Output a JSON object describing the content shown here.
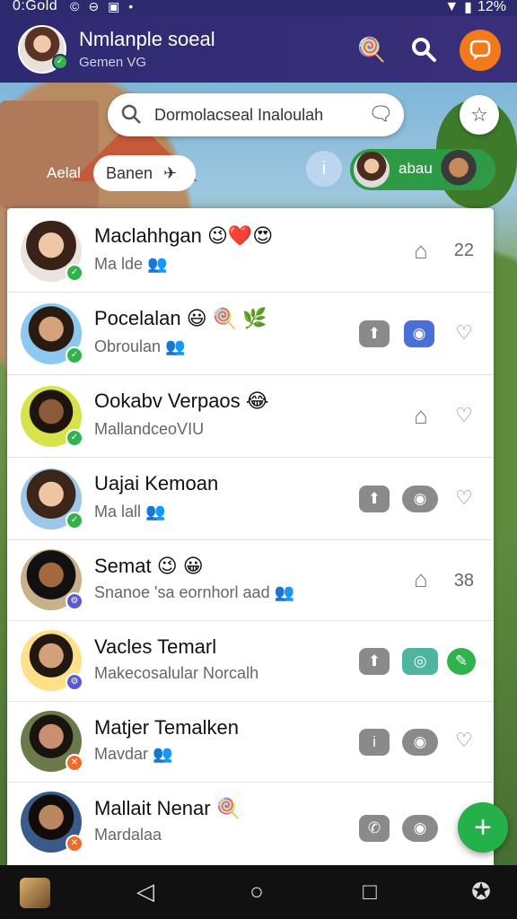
{
  "status_bar": {
    "time": "0:Gold",
    "icons": [
      "©",
      "⊖",
      "▣",
      "•"
    ],
    "battery": "12%"
  },
  "header": {
    "title": "Nmlanple soeal",
    "subtitle": "Gemen VG",
    "icons": [
      "lollipop-icon",
      "search-icon",
      "chat-icon"
    ],
    "colors": {
      "bg": "#2e2a72",
      "accent": "#f27a1a"
    }
  },
  "search": {
    "value": "Dormolacseal Inaloulah"
  },
  "filters": {
    "label": "Aelal",
    "pill_label": "Banen",
    "chip_label": "abau"
  },
  "contacts": [
    {
      "name": "Maclahhgan 😉❤️😍",
      "sub": "Ma lde 👥",
      "count": "22",
      "badge_color": "#2fb34a"
    },
    {
      "name": "Pocelalan 😃 🍭 🌿",
      "sub": "Obroulan 👥",
      "count": "",
      "badge_color": "#2fb34a"
    },
    {
      "name": "Ookabv Verpaos 😂",
      "sub": "MallandceoVIU",
      "count": "",
      "badge_color": "#2fb34a"
    },
    {
      "name": "Uajai Kemoan",
      "sub": "Ma lall 👥",
      "count": "",
      "badge_color": "#2fb34a"
    },
    {
      "name": "Semat 😉 😀",
      "sub": "Snanoe 'sa eornhorl aad 👥",
      "count": "38",
      "badge_color": "#5a5ad0"
    },
    {
      "name": "Vacles Temarl",
      "sub": "Makecosalular Norcalh",
      "count": "",
      "badge_color": "#5a5ad0"
    },
    {
      "name": "Matjer Temalken",
      "sub": "Mavdar 👥",
      "count": "",
      "badge_color": "#f06a2a"
    },
    {
      "name": "Mallait Nenar 🍭",
      "sub": "Mardalaa",
      "count": "",
      "badge_color": "#f06a2a"
    }
  ],
  "fab_label": "+",
  "nav": {
    "back": "◁",
    "home": "○",
    "recents": "□"
  }
}
